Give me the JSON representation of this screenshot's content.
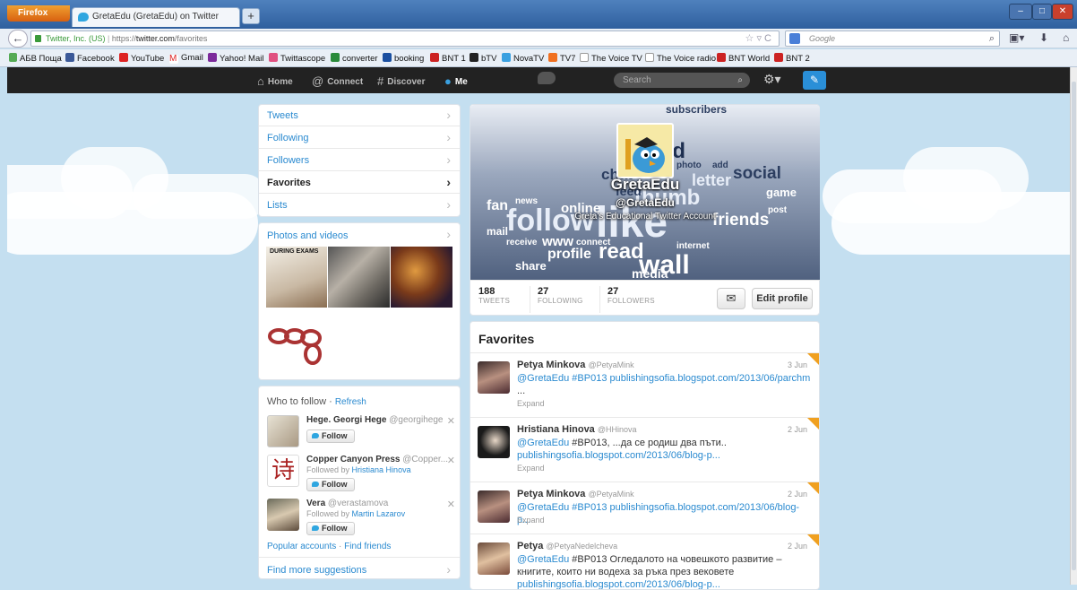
{
  "browser": {
    "app_button": "Firefox",
    "tab_title": "GretaEdu (GretaEdu) on Twitter",
    "new_tab": "+",
    "url_company": "Twitter, Inc. (US)",
    "url_prefix": "https://",
    "url_host": "twitter.com",
    "url_path": "/favorites",
    "search_engine_placeholder": "Google",
    "bookmarks": [
      "АБВ Поща",
      "Facebook",
      "YouTube",
      "Gmail",
      "Yahoo! Mail",
      "Twittascope",
      "converter",
      "booking",
      "BNT 1",
      "bTV",
      "NovaTV",
      "TV7",
      "The Voice TV",
      "The Voice radio",
      "BNT World",
      "BNT 2"
    ]
  },
  "twitter_nav": {
    "home": "Home",
    "connect": "Connect",
    "discover": "Discover",
    "me": "Me",
    "search_placeholder": "Search"
  },
  "sidebar": {
    "items": [
      {
        "label": "Tweets"
      },
      {
        "label": "Following"
      },
      {
        "label": "Followers"
      },
      {
        "label": "Favorites"
      },
      {
        "label": "Lists"
      }
    ],
    "photos_title": "Photos and videos",
    "photo_caption": "DURING EXAMS"
  },
  "who_to_follow": {
    "title": "Who to follow",
    "refresh": "Refresh",
    "follow_label": "Follow",
    "users": [
      {
        "name": "Hege. Georgi Hege",
        "handle": "@georgihege",
        "followed_by_prefix": "",
        "followed_by": ""
      },
      {
        "name": "Copper Canyon Press",
        "handle": "@Copper...",
        "followed_by_prefix": "Followed by",
        "followed_by": "Hristiana Hinova"
      },
      {
        "name": "Vera",
        "handle": "@verastamova",
        "followed_by_prefix": "Followed by",
        "followed_by": "Martin Lazarov"
      }
    ],
    "popular": "Popular accounts",
    "find_friends": "Find friends",
    "find_more": "Find more suggestions"
  },
  "profile": {
    "name": "GretaEdu",
    "handle": "@GretaEdu",
    "bio": "Greta's Educational Twitter Account",
    "stats": [
      {
        "value": "188",
        "label": "TWEETS"
      },
      {
        "value": "27",
        "label": "FOLLOWING"
      },
      {
        "value": "27",
        "label": "FOLLOWERS"
      }
    ],
    "edit_profile": "Edit profile",
    "header_words": [
      "subscribers",
      "find",
      "social",
      "letter",
      "thumb",
      "follow",
      "like",
      "online",
      "fan",
      "friends",
      "wall",
      "read",
      "profile",
      "media",
      "share",
      "www",
      "chat",
      "feed",
      "news",
      "game",
      "add",
      "photo",
      "mail",
      "receive",
      "connect",
      "internet",
      "post"
    ]
  },
  "favorites": {
    "title": "Favorites",
    "expand": "Expand",
    "tweets": [
      {
        "name": "Petya Minkova",
        "handle": "@PetyaMink",
        "date": "3 Jun",
        "mention": "@GretaEdu",
        "text": " #BP013 publishingsofia.blogspot.com/2013/06/parchm",
        "line2": "...",
        "link2": ""
      },
      {
        "name": "Hristiana Hinova",
        "handle": "@HHinova",
        "date": "2 Jun",
        "mention": "@GretaEdu",
        "text": " #BP013, ...да се родиш два пъти..",
        "line2": "",
        "link2": "publishingsofia.blogspot.com/2013/06/blog-p..."
      },
      {
        "name": "Petya Minkova",
        "handle": "@PetyaMink",
        "date": "2 Jun",
        "mention": "@GretaEdu",
        "text": " #BP013 publishingsofia.blogspot.com/2013/06/blog-p...",
        "line2": "",
        "link2": ""
      },
      {
        "name": "Petya",
        "handle": "@PetyaNedelcheva",
        "date": "2 Jun",
        "mention": "@GretaEdu",
        "text": " #BP013 Огледалото на човешкото развитие –",
        "line2": "книгите, които ни водеха за ръка през вековете",
        "link2": "publishingsofia.blogspot.com/2013/06/blog-p..."
      }
    ]
  },
  "colors": {
    "link": "#2a8ad0",
    "topbar": "#222222",
    "background": "#c4dff0",
    "favorite_corner": "#f0a020"
  }
}
